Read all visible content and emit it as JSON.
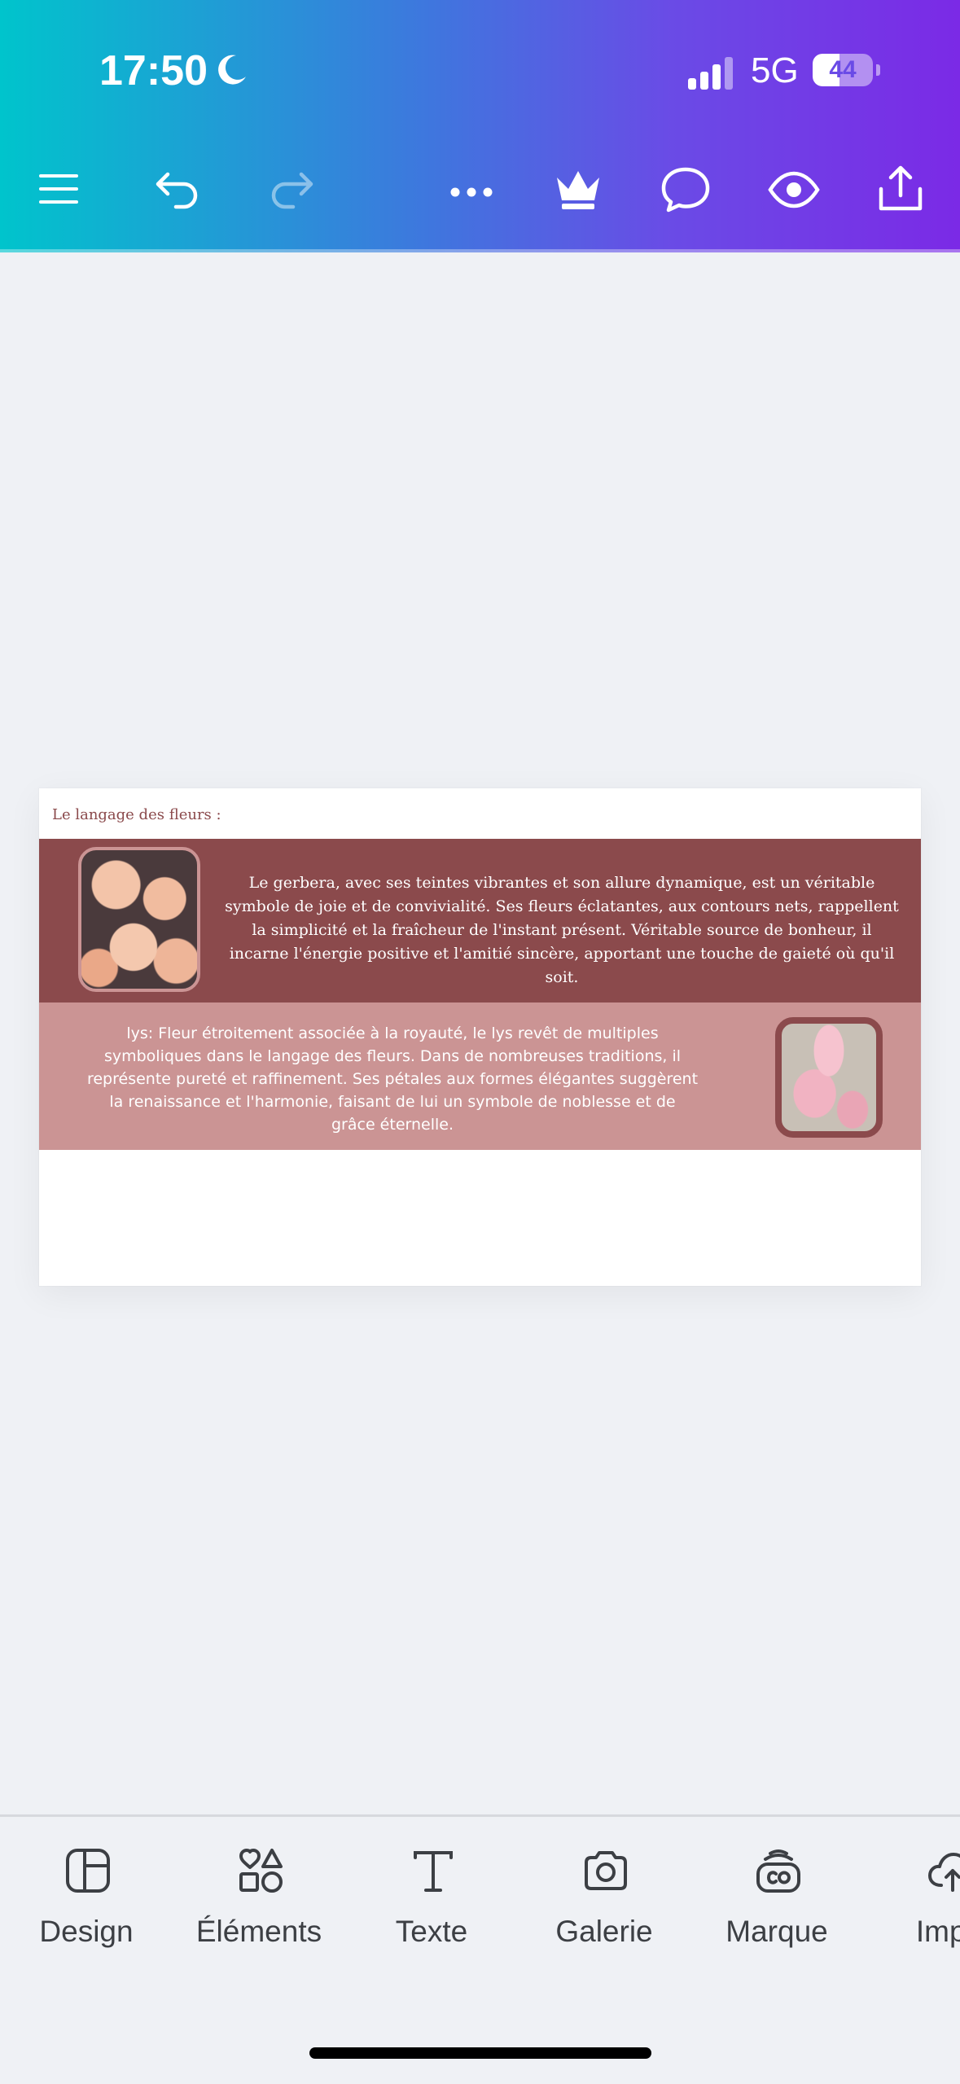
{
  "status_bar": {
    "time": "17:50",
    "network": "5G",
    "battery_level": 44,
    "battery_label": "44"
  },
  "toolbar": {
    "menu_icon": "menu-icon",
    "undo_icon": "undo-icon",
    "redo_icon": "redo-icon",
    "more_icon": "more-icon",
    "premium_icon": "crown-icon",
    "comment_icon": "comment-icon",
    "preview_icon": "eye-icon",
    "share_icon": "share-icon"
  },
  "design": {
    "title": "Le langage des fleurs :",
    "gerbera_text": "Le gerbera, avec ses teintes vibrantes et son allure dynamique, est un véritable symbole de joie et de convivialité. Ses fleurs éclatantes, aux contours nets, rappellent la simplicité et la fraîcheur de l'instant présent. Véritable source de bonheur, il incarne l'énergie positive et l'amitié sincère, apportant une touche de gaieté où qu'il soit.",
    "lys_text": "lys: Fleur étroitement associée à la royauté, le lys revêt de multiples symboliques dans le langage des fleurs. Dans de nombreuses traditions, il représente pureté et raffinement. Ses pétales aux formes élégantes suggèrent la renaissance et l'harmonie, faisant de lui un symbole de noblesse et de grâce éternelle.",
    "colors": {
      "dark_band": "#8b4a4c",
      "light_band": "#cb9494",
      "title": "#8b4a4c"
    }
  },
  "bottom_nav": {
    "items": [
      {
        "label": "Design",
        "icon": "layout-icon"
      },
      {
        "label": "Éléments",
        "icon": "shapes-icon"
      },
      {
        "label": "Texte",
        "icon": "text-icon"
      },
      {
        "label": "Galerie",
        "icon": "camera-icon"
      },
      {
        "label": "Marque",
        "icon": "brand-icon"
      },
      {
        "label": "Impo",
        "icon": "cloud-upload-icon"
      }
    ]
  },
  "theme": {
    "header_gradient": [
      "#00c4cc",
      "#7b2ae6"
    ],
    "background": "#eff1f5"
  }
}
